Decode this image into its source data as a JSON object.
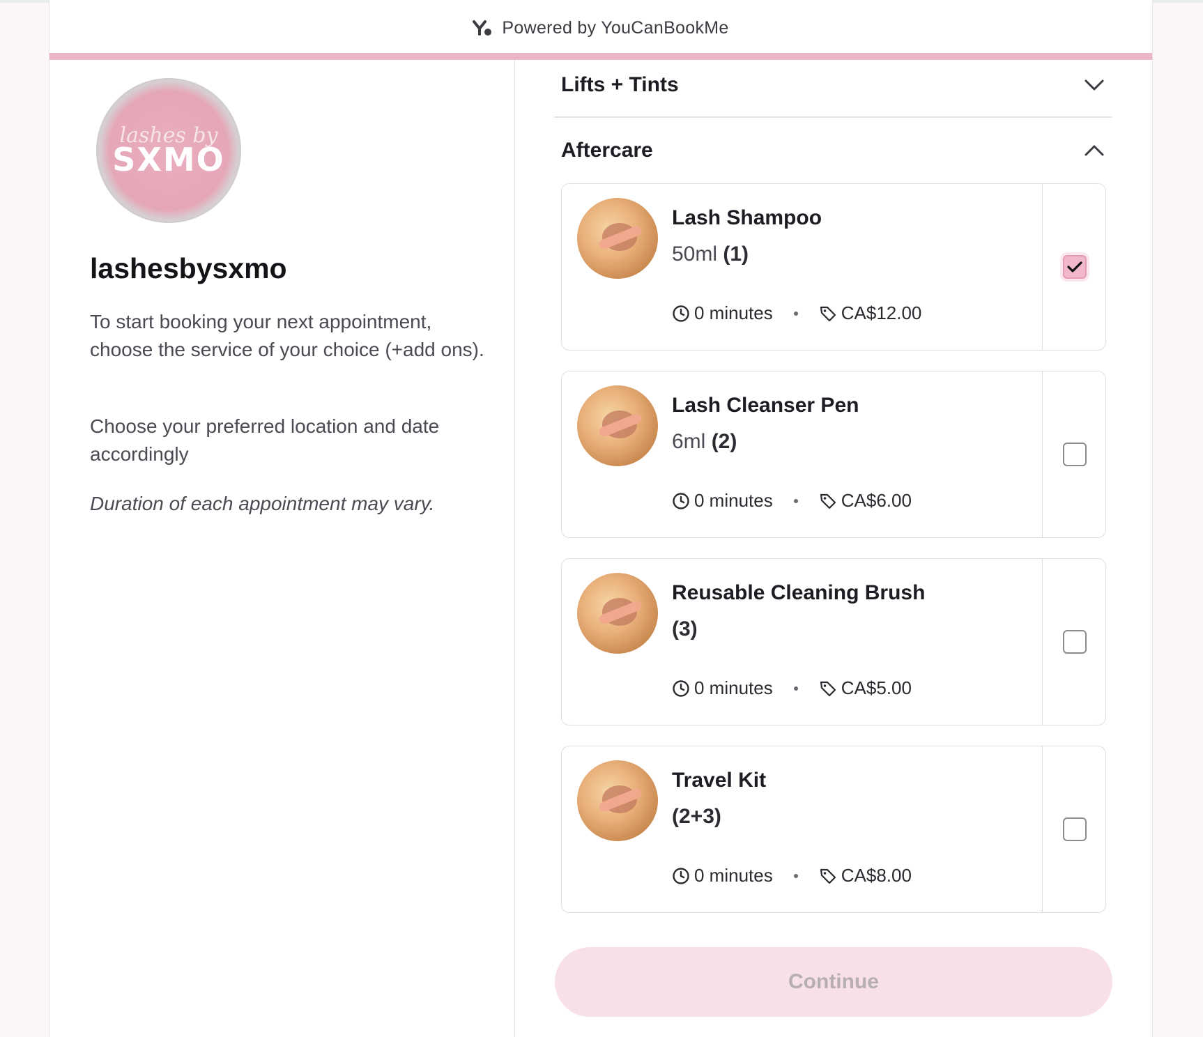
{
  "header": {
    "powered_by": "Powered by YouCanBookMe"
  },
  "profile": {
    "logo_script": "lashes by",
    "logo_word": "SXMO",
    "name": "lashesbysxmo",
    "description_1": "To start booking your next appointment, choose the service of your choice (+add ons).",
    "description_2": "Choose your preferred location and date accordingly",
    "description_3": "Duration of each appointment may vary."
  },
  "sections": [
    {
      "title": "Lifts + Tints",
      "expanded": false,
      "chevron": "chevron-down-icon"
    },
    {
      "title": "Aftercare",
      "expanded": true,
      "chevron": "chevron-up-icon"
    }
  ],
  "items": [
    {
      "name": "Lash Shampoo",
      "variant": "50ml",
      "code": "(1)",
      "duration": "0 minutes",
      "price": "CA$12.00",
      "selected": true
    },
    {
      "name": "Lash Cleanser Pen",
      "variant": "6ml",
      "code": "(2)",
      "duration": "0 minutes",
      "price": "CA$6.00",
      "selected": false
    },
    {
      "name": "Reusable Cleaning Brush",
      "variant": "",
      "code": "(3)",
      "duration": "0 minutes",
      "price": "CA$5.00",
      "selected": false
    },
    {
      "name": "Travel Kit",
      "variant": "",
      "code": "(2+3)",
      "duration": "0 minutes",
      "price": "CA$8.00",
      "selected": false
    }
  ],
  "actions": {
    "continue_label": "Continue"
  },
  "colors": {
    "accent": "#ebb6c8",
    "checked_bg": "#f0b8c9",
    "button_bg": "#f8e0e7"
  }
}
